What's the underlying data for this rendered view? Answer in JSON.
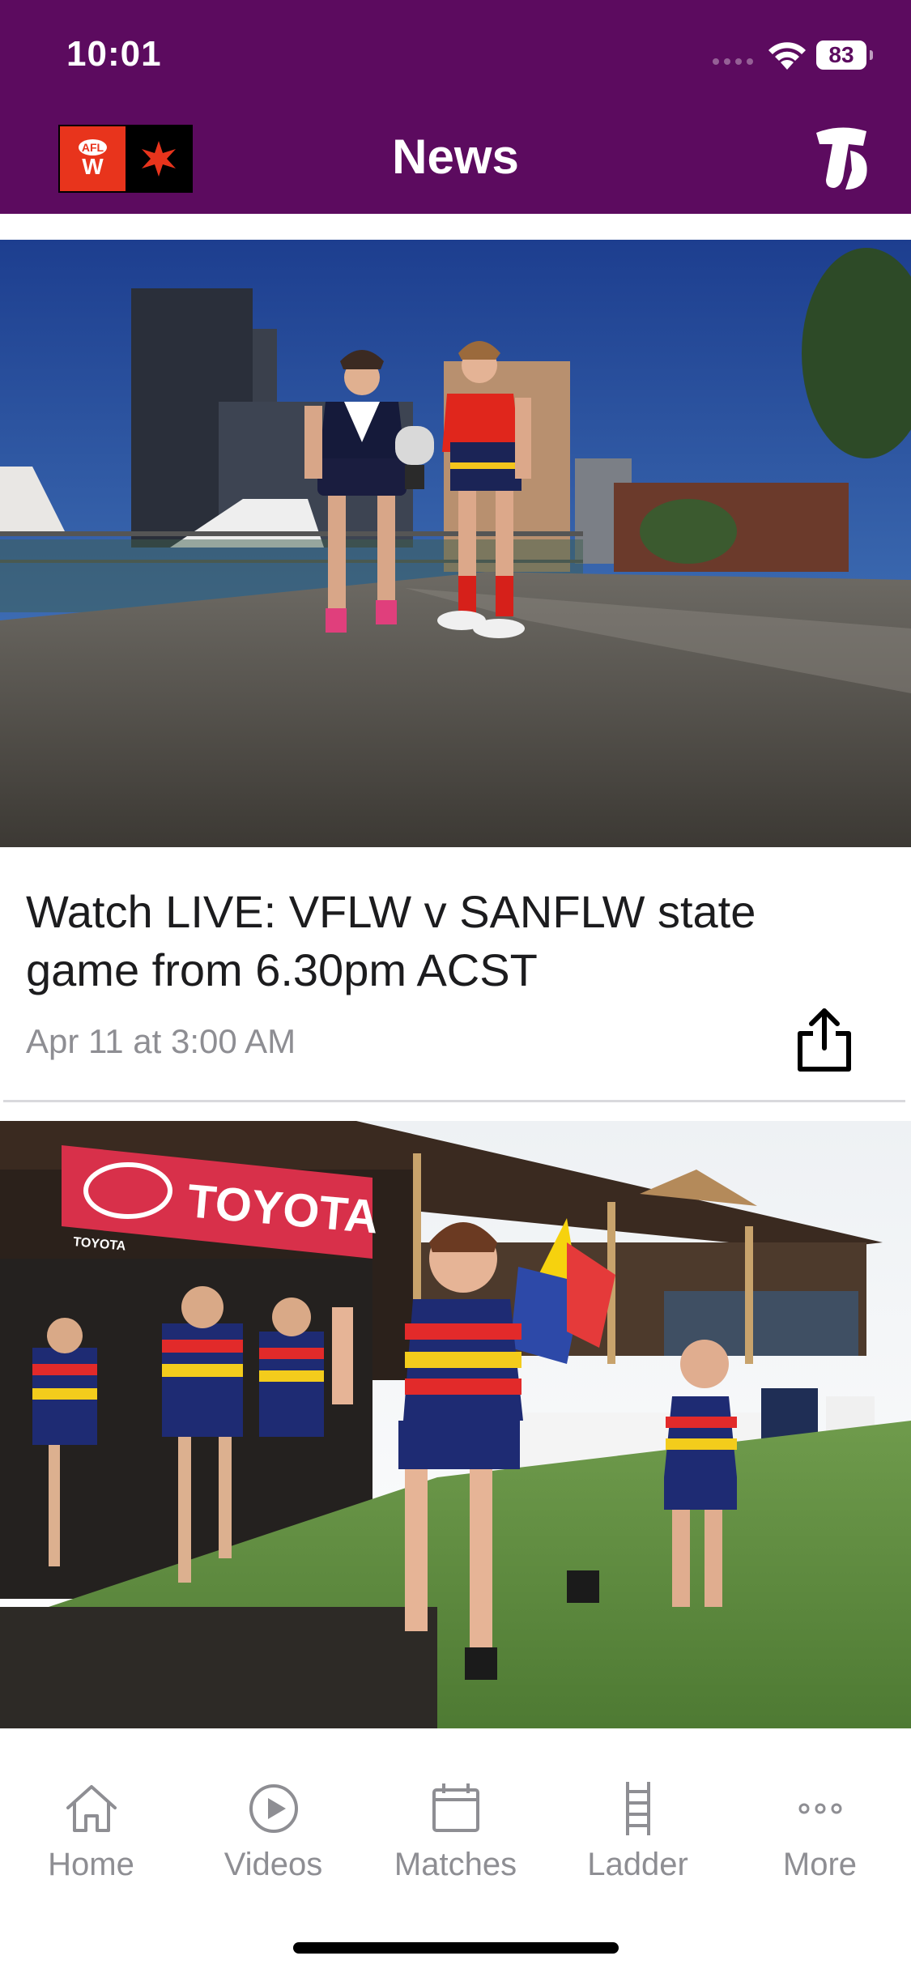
{
  "theme": {
    "brand": "#5c0b5f",
    "muted": "#8e8e93",
    "text": "#1c1c1e"
  },
  "status_bar": {
    "time": "10:01",
    "battery": "83"
  },
  "nav": {
    "title": "News",
    "logo": {
      "afl_text": "AFL",
      "w_text": "W"
    }
  },
  "articles": [
    {
      "headline": "Watch LIVE: VFLW v SANFLW state game from 6.30pm ACST",
      "date": "Apr 11 at 3:00 AM",
      "image_icon": "photo-players-with-trophy"
    },
    {
      "image_icon": "photo-team-running-out",
      "banner_text": "TOYOTA",
      "banner_small": "TOYOTA"
    }
  ],
  "tabs": [
    {
      "label": "Home",
      "icon": "house-icon"
    },
    {
      "label": "Videos",
      "icon": "play-icon"
    },
    {
      "label": "Matches",
      "icon": "calendar-icon"
    },
    {
      "label": "Ladder",
      "icon": "ladder-icon"
    },
    {
      "label": "More",
      "icon": "more-icon"
    }
  ]
}
